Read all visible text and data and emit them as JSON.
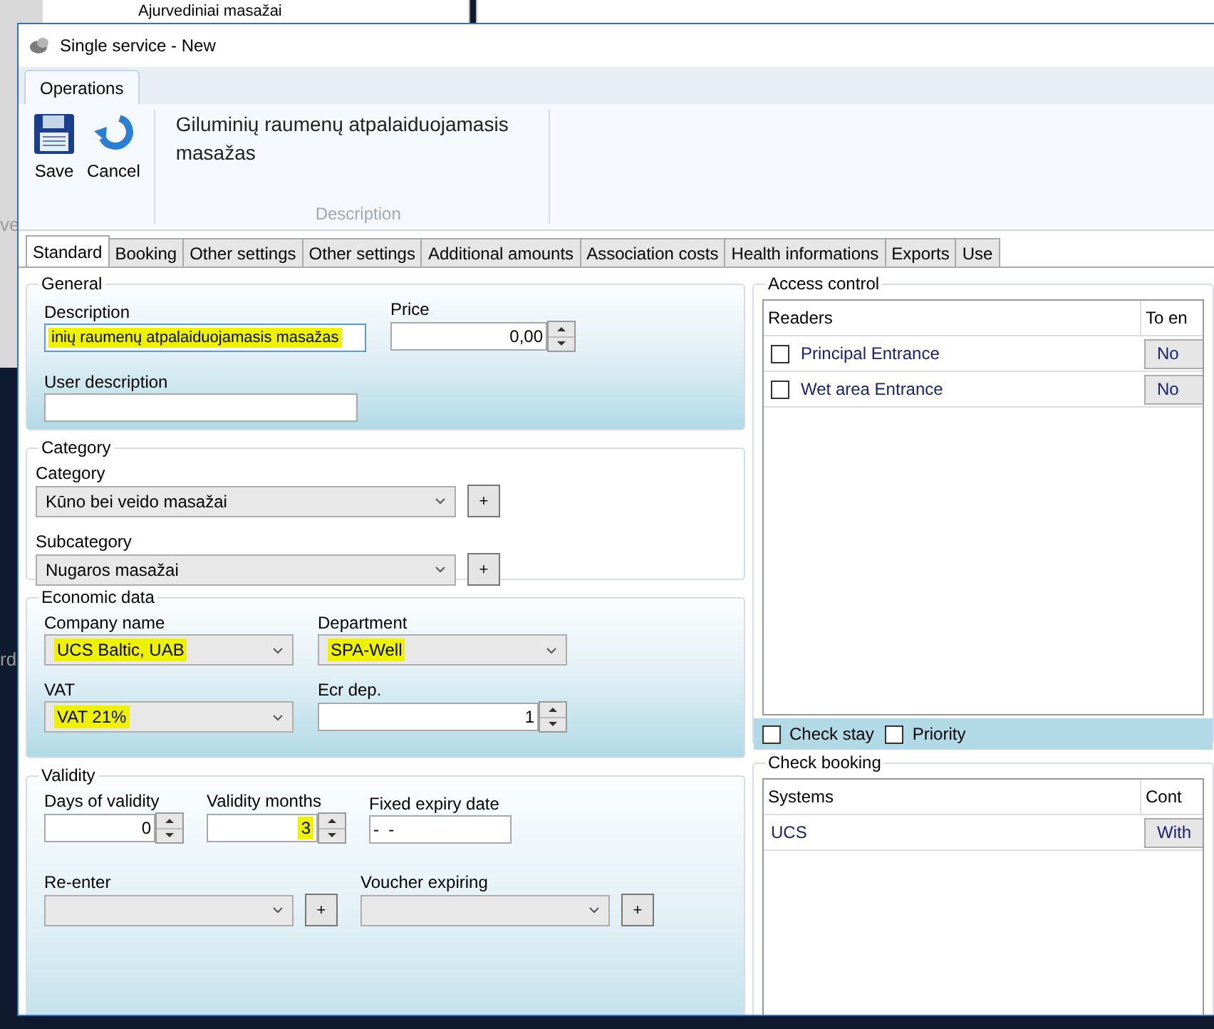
{
  "background_app": {
    "tree_item": "Ajurvediniai masažai",
    "side_texts": [
      "ve",
      "rd"
    ]
  },
  "window": {
    "title": "Single service - New"
  },
  "ribbon": {
    "tabs": [
      {
        "label": "Operations",
        "selected": true
      }
    ],
    "buttons": [
      {
        "label": "Save"
      },
      {
        "label": "Cancel"
      }
    ],
    "description": "Giluminių raumenų atpalaiduojamasis masažas",
    "group_label": "Description"
  },
  "tabs": [
    {
      "label": "Standard",
      "selected": true
    },
    {
      "label": "Booking",
      "selected": false
    },
    {
      "label": "Other settings",
      "selected": false
    },
    {
      "label": "Other settings",
      "selected": false
    },
    {
      "label": "Additional amounts",
      "selected": false
    },
    {
      "label": "Association costs",
      "selected": false
    },
    {
      "label": "Health informations",
      "selected": false
    },
    {
      "label": "Exports",
      "selected": false
    },
    {
      "label": "Use",
      "selected": false
    }
  ],
  "sections": [
    {
      "kind": "general",
      "title": "General",
      "fields": [
        {
          "label": "Description",
          "kind": "text",
          "value": "inių raumenų atpalaiduojamasis masažas",
          "highlighted": true,
          "focused": true
        },
        {
          "label": "Price",
          "kind": "number",
          "value": "0,00",
          "highlighted": false
        },
        {
          "label": "User description",
          "kind": "text",
          "focused": false
        }
      ]
    },
    {
      "kind": "category",
      "title": "Category",
      "fields": [
        {
          "label": "Category",
          "kind": "combo",
          "value": "Kūno bei veido masažai",
          "highlighted": false,
          "add_label": "+"
        },
        {
          "label": "Subcategory",
          "kind": "combo",
          "value": "Nugaros masažai",
          "highlighted": false,
          "add_label": "+"
        }
      ]
    },
    {
      "kind": "economic",
      "title": "Economic data",
      "fields": [
        {
          "label": "Company name",
          "kind": "combo",
          "value": "UCS Baltic, UAB",
          "highlighted": true
        },
        {
          "label": "Department",
          "kind": "combo",
          "value": "SPA-Well",
          "highlighted": true
        },
        {
          "label": "VAT",
          "kind": "combo",
          "value": "VAT 21%",
          "highlighted": true
        },
        {
          "label": "Ecr dep.",
          "kind": "number",
          "value": "1",
          "highlighted": false
        }
      ]
    },
    {
      "kind": "validity",
      "title": "Validity",
      "fields": [
        {
          "label": "Days of validity",
          "kind": "number",
          "value": "0",
          "highlighted": false
        },
        {
          "label": "Validity months",
          "kind": "number",
          "value": "3",
          "highlighted": true
        },
        {
          "label": "Fixed expiry date",
          "kind": "date",
          "value": "-  -",
          "highlighted": false
        },
        {
          "label": "Re-enter",
          "kind": "combo",
          "add_label": "+"
        },
        {
          "label": "Voucher expiring",
          "kind": "combo",
          "add_label": "+"
        }
      ]
    }
  ],
  "access_control": {
    "title": "Access control",
    "columns": [
      "Readers",
      "To en"
    ],
    "rows": [
      {
        "name": "Principal Entrance",
        "checked": false,
        "value": "No"
      },
      {
        "name": "Wet area Entrance",
        "checked": false,
        "value": "No"
      }
    ],
    "options": [
      {
        "label": "Check stay",
        "checked": false
      },
      {
        "label": "Priority",
        "checked": false
      }
    ]
  },
  "check_booking": {
    "title": "Check booking",
    "columns": [
      "Systems",
      "Cont"
    ],
    "rows": [
      {
        "name": "UCS",
        "value": "With"
      }
    ]
  }
}
